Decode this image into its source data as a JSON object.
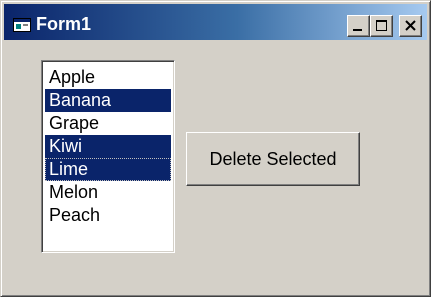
{
  "window": {
    "title": "Form1",
    "icon": "form-icon",
    "caption_buttons": [
      "minimize-icon",
      "maximize-icon",
      "close-icon"
    ]
  },
  "listbox": {
    "items": [
      {
        "label": "Apple",
        "selected": false
      },
      {
        "label": "Banana",
        "selected": true
      },
      {
        "label": "Grape",
        "selected": false
      },
      {
        "label": "Kiwi",
        "selected": true
      },
      {
        "label": "Lime",
        "selected": true,
        "focused": true
      },
      {
        "label": "Melon",
        "selected": false
      },
      {
        "label": "Peach",
        "selected": false
      }
    ]
  },
  "actions": {
    "delete_label": "Delete Selected"
  },
  "colors": {
    "titlebar_start": "#0a246a",
    "titlebar_end": "#a6caf0",
    "selection": "#0a246a",
    "face": "#d4d0c8"
  }
}
